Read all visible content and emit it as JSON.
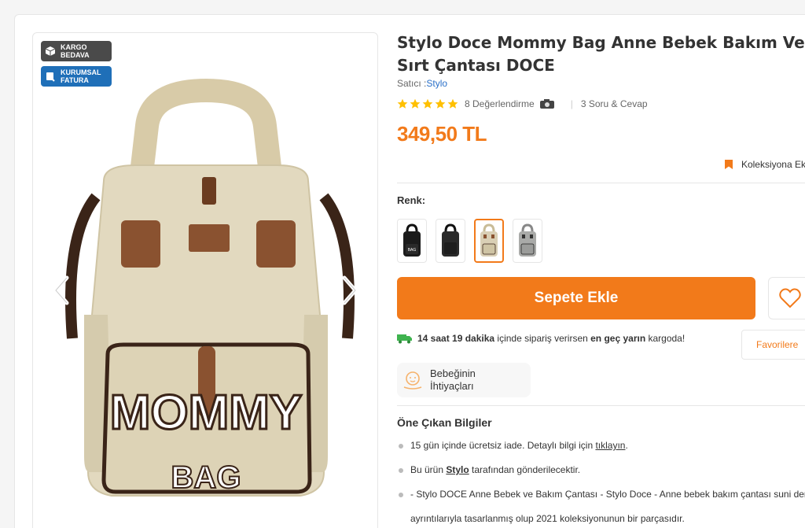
{
  "badges": {
    "cargo_line1": "KARGO",
    "cargo_line2": "BEDAVA",
    "corp_line1": "KURUMSAL",
    "corp_line2": "FATURA"
  },
  "product": {
    "brand": "Stylo",
    "title": " Doce Mommy Bag Anne Bebek Bakım Ve Sırt Çantası DOCE",
    "seller_label": "Satıcı :",
    "seller_name": "Stylo",
    "rating_count": "8 Değerlendirme",
    "qa": "3 Soru & Cevap",
    "price": "349,50 TL",
    "rating": 5,
    "bag_text_top": "MOMMY",
    "bag_text_bottom": "BAG"
  },
  "collection": {
    "label": "Koleksiyona Ek"
  },
  "variants": {
    "label": "Renk:",
    "selected_index": 2,
    "colors": [
      "#1b1b1b",
      "#2a2a2a",
      "#d9cfb5",
      "#a9aaa8"
    ]
  },
  "cart": {
    "add_label": "Sepete Ekle"
  },
  "favorite": {
    "tooltip": "Favorilere"
  },
  "delivery": {
    "time": "14 saat 19 dakika",
    "text1": " içinde sipariş verirsen ",
    "strong": "en geç yarın",
    "text2": " kargoda!"
  },
  "baby_needs": {
    "line1": "Bebeğinin",
    "line2": "İhtiyaçları"
  },
  "features": {
    "title": "Öne Çıkan Bilgiler",
    "item1_a": "15 gün içinde ücretsiz iade. Detaylı bilgi için ",
    "item1_link": "tıklayın",
    "item1_b": ".",
    "item2_a": "Bu ürün ",
    "item2_link": "Stylo",
    "item2_b": " tarafından gönderilecektir.",
    "item3": "- Stylo DOCE Anne Bebek ve Bakım Çantası - Stylo Doce - Anne bebek bakım çantası suni deri",
    "item3_cont": "ayrıntılarıyla tasarlanmış olup 2021 koleksiyonunun bir parçasıdır."
  },
  "colors": {
    "accent": "#f27a1a",
    "link": "#2a70c9",
    "cargo_badge": "#4a4a4a",
    "corp_badge": "#1f6fb8"
  }
}
